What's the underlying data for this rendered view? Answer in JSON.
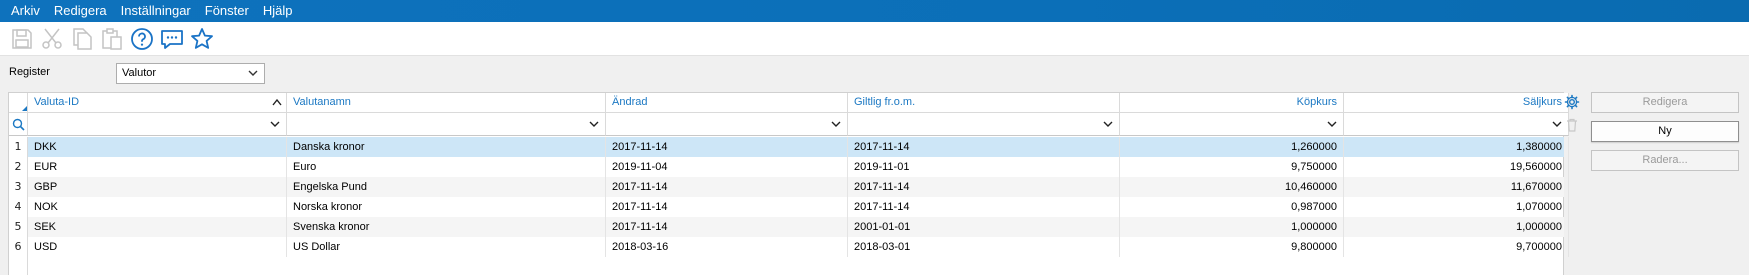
{
  "menu": [
    "Arkiv",
    "Redigera",
    "Inställningar",
    "Fönster",
    "Hjälp"
  ],
  "toolbar": {
    "icons": [
      "save-icon",
      "cut-icon",
      "copy-icon",
      "paste-icon",
      "help-icon",
      "chat-icon",
      "star-icon"
    ]
  },
  "register": {
    "label": "Register",
    "value": "Valutor"
  },
  "table": {
    "columns": [
      "Valuta-ID",
      "Valutanamn",
      "Ändrad",
      "Giltlig fr.o.m.",
      "Köpkurs",
      "Säljkurs"
    ],
    "rows": [
      {
        "n": "1",
        "id": "DKK",
        "name": "Danska kronor",
        "changed": "2017-11-14",
        "valid": "2017-11-14",
        "buy": "1,260000",
        "sell": "1,380000"
      },
      {
        "n": "2",
        "id": "EUR",
        "name": "Euro",
        "changed": "2019-11-04",
        "valid": "2019-11-01",
        "buy": "9,750000",
        "sell": "19,560000"
      },
      {
        "n": "3",
        "id": "GBP",
        "name": "Engelska Pund",
        "changed": "2017-11-14",
        "valid": "2017-11-14",
        "buy": "10,460000",
        "sell": "11,670000"
      },
      {
        "n": "4",
        "id": "NOK",
        "name": "Norska kronor",
        "changed": "2017-11-14",
        "valid": "2017-11-14",
        "buy": "0,987000",
        "sell": "1,070000"
      },
      {
        "n": "5",
        "id": "SEK",
        "name": "Svenska kronor",
        "changed": "2017-11-14",
        "valid": "2001-01-01",
        "buy": "1,000000",
        "sell": "1,000000"
      },
      {
        "n": "6",
        "id": "USD",
        "name": "US Dollar",
        "changed": "2018-03-16",
        "valid": "2018-03-01",
        "buy": "9,800000",
        "sell": "9,700000"
      }
    ]
  },
  "buttons": {
    "edit": "Redigera",
    "new": "Ny",
    "delete": "Radera..."
  }
}
